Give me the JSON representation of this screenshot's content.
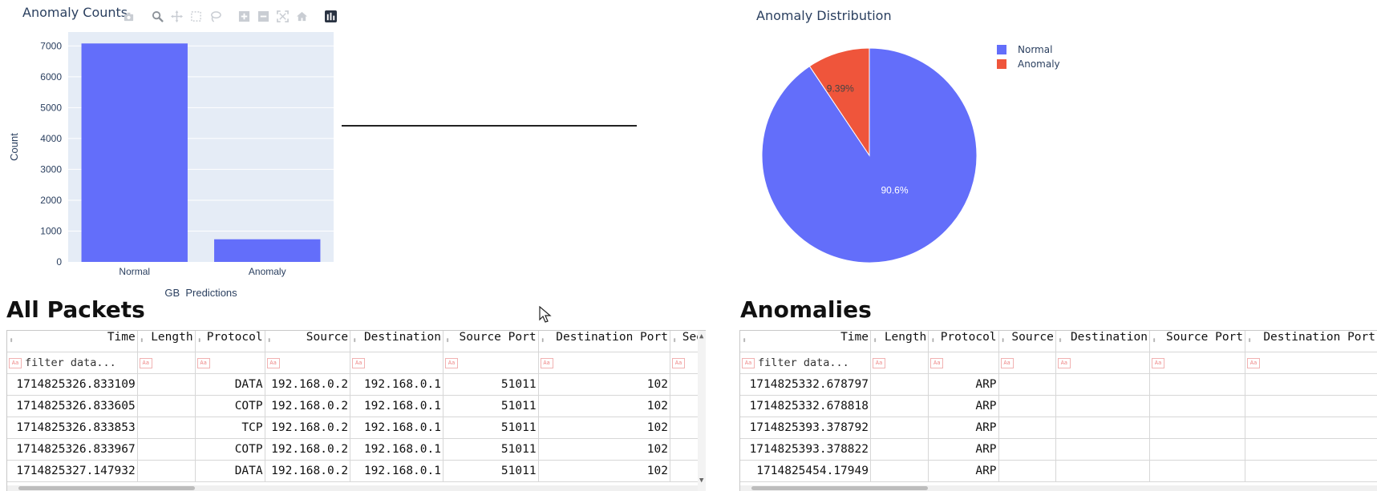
{
  "bar_chart": {
    "title": "Anomaly Counts",
    "modebar": [
      "camera-icon",
      "zoom-icon",
      "pan-icon",
      "box-select-icon",
      "lasso-select-icon",
      "zoom-in-icon",
      "zoom-out-icon",
      "autoscale-icon",
      "reset-axes-icon",
      "plotly-logo-icon"
    ]
  },
  "pie_chart": {
    "title": "Anomaly Distribution"
  },
  "chart_data": [
    {
      "type": "bar",
      "title": "Anomaly Counts",
      "categories": [
        "Normal",
        "Anomaly"
      ],
      "values": [
        7080,
        734
      ],
      "xlabel": "GB_Predictions",
      "ylabel": "Count",
      "ylim": [
        0,
        7450
      ],
      "yticks": [
        0,
        1000,
        2000,
        3000,
        4000,
        5000,
        6000,
        7000
      ],
      "color": "#636efa",
      "plot_bg": "#e5ecf6",
      "grid": true
    },
    {
      "type": "pie",
      "title": "Anomaly Distribution",
      "labels": [
        "Normal",
        "Anomaly"
      ],
      "values": [
        90.6,
        9.39
      ],
      "text": [
        "90.6%",
        "9.39%"
      ],
      "colors": [
        "#636efa",
        "#ef553b"
      ],
      "legend": "top-right"
    }
  ],
  "sections": {
    "all_packets": "All Packets",
    "anomalies": "Anomalies"
  },
  "filter_placeholder": "filter data...",
  "all_packets_table": {
    "columns": [
      "Time",
      "Length",
      "Protocol",
      "Source",
      "Destination",
      "Source Port",
      "Destination Port",
      "Seq"
    ],
    "rows": [
      [
        "1714825326.833109",
        "",
        "DATA",
        "192.168.0.2",
        "192.168.0.1",
        "51011",
        "102",
        ""
      ],
      [
        "1714825326.833605",
        "",
        "COTP",
        "192.168.0.2",
        "192.168.0.1",
        "51011",
        "102",
        ""
      ],
      [
        "1714825326.833853",
        "",
        "TCP",
        "192.168.0.2",
        "192.168.0.1",
        "51011",
        "102",
        ""
      ],
      [
        "1714825326.833967",
        "",
        "COTP",
        "192.168.0.2",
        "192.168.0.1",
        "51011",
        "102",
        ""
      ],
      [
        "1714825327.147932",
        "",
        "DATA",
        "192.168.0.2",
        "192.168.0.1",
        "51011",
        "102",
        ""
      ]
    ]
  },
  "anomalies_table": {
    "columns": [
      "Time",
      "Length",
      "Protocol",
      "Source",
      "Destination",
      "Source Port",
      "Destination Port"
    ],
    "rows": [
      [
        "1714825332.678797",
        "",
        "ARP",
        "",
        "",
        "",
        ""
      ],
      [
        "1714825332.678818",
        "",
        "ARP",
        "",
        "",
        "",
        ""
      ],
      [
        "1714825393.378792",
        "",
        "ARP",
        "",
        "",
        "",
        ""
      ],
      [
        "1714825393.378822",
        "",
        "ARP",
        "",
        "",
        "",
        ""
      ],
      [
        "1714825454.17949",
        "",
        "ARP",
        "",
        "",
        "",
        ""
      ]
    ]
  }
}
